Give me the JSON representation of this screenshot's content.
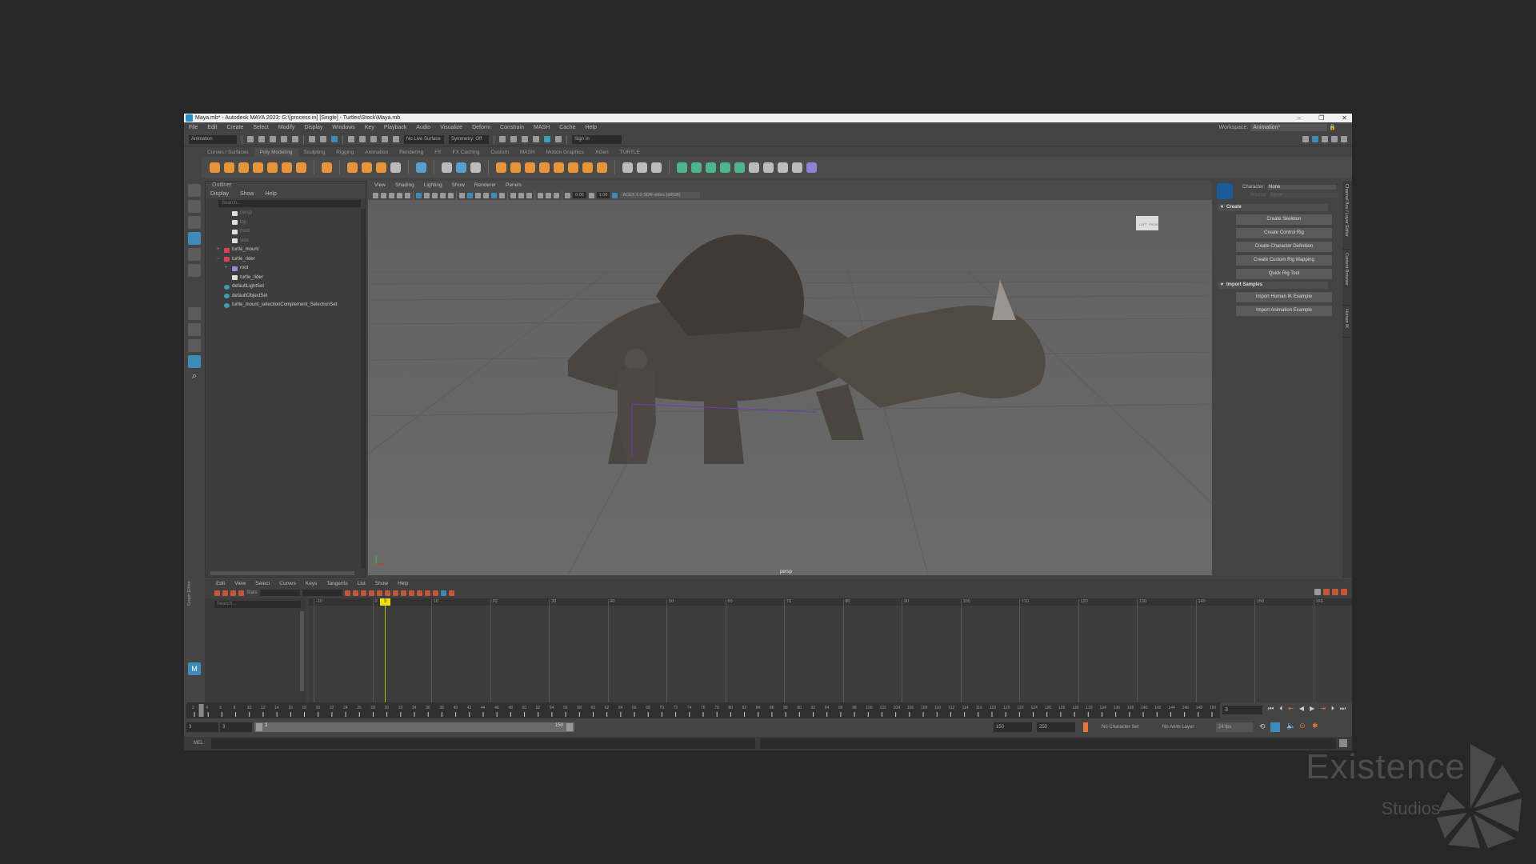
{
  "window": {
    "title": "Maya.mb* - Autodesk MAYA 2023: G:\\[process in] [Single] - Turtles\\Stock\\Maya.mb",
    "controls": [
      "–",
      "❐",
      "✕"
    ]
  },
  "menubar": [
    "File",
    "Edit",
    "Create",
    "Select",
    "Modify",
    "Display",
    "Windows",
    "Key",
    "Playback",
    "Audio",
    "Visualize",
    "Deform",
    "Constrain",
    "MASH",
    "Cache",
    "Help"
  ],
  "workspace": {
    "label": "Workspace:",
    "value": "Animation*"
  },
  "statusline": {
    "mode": "Animation",
    "live_surface": "No Live Surface",
    "symmetry": "Symmetry: Off",
    "sign_in": "Sign In"
  },
  "shelf": {
    "tabs": [
      "Curves / Surfaces",
      "Poly Modeling",
      "Sculpting",
      "Rigging",
      "Animation",
      "Rendering",
      "FX",
      "FX Caching",
      "Custom",
      "MASH",
      "Motion Graphics",
      "XGen",
      "TURTLE"
    ],
    "active": 1
  },
  "outliner": {
    "title": "Outliner",
    "menu": [
      "Display",
      "Show",
      "Help"
    ],
    "search_placeholder": "Search...",
    "items": [
      {
        "label": "persp",
        "indent": 1,
        "icon": "camera",
        "dim": true
      },
      {
        "label": "top",
        "indent": 1,
        "icon": "camera",
        "dim": true
      },
      {
        "label": "front",
        "indent": 1,
        "icon": "camera",
        "dim": true
      },
      {
        "label": "side",
        "indent": 1,
        "icon": "camera",
        "dim": true
      },
      {
        "label": "turtle_mount",
        "indent": 0,
        "icon": "transform",
        "expand": "+"
      },
      {
        "label": "turtle_rider",
        "indent": 0,
        "icon": "transform",
        "expand": "−"
      },
      {
        "label": "root",
        "indent": 1,
        "icon": "joint",
        "expand": "+"
      },
      {
        "label": "turtle_rider",
        "indent": 1,
        "icon": "mesh"
      },
      {
        "label": "defaultLightSet",
        "indent": 0,
        "icon": "set"
      },
      {
        "label": "defaultObjectSet",
        "indent": 0,
        "icon": "set"
      },
      {
        "label": "turtle_mount_selectionComplement_SelectionSet",
        "indent": 0,
        "icon": "set"
      }
    ]
  },
  "viewport": {
    "menu": [
      "View",
      "Shading",
      "Lighting",
      "Show",
      "Renderer",
      "Panels"
    ],
    "exposure": "0.00",
    "gamma": "1.00",
    "color_space": "ACES 1.0 SDR-video (sRGB)",
    "camera": "persp",
    "viewcube": [
      "LEFT",
      "FRONT"
    ]
  },
  "hik": {
    "character_label": "Character:",
    "character": "None",
    "source_label": "Source:",
    "source": "None",
    "sections": [
      {
        "title": "Create",
        "buttons": [
          "Create Skeleton",
          "Create Control Rig",
          "Create Character Definition",
          "Create Custom Rig Mapping",
          "Quick Rig Tool"
        ]
      },
      {
        "title": "Import Samples",
        "buttons": [
          "Import Human IK Example",
          "Import Animation Example"
        ]
      }
    ],
    "side_tabs": [
      "Channel Box / Layer Editor",
      "Content Browser",
      "Human IK"
    ]
  },
  "graph_editor": {
    "side_label": "Graph Editor",
    "menu": [
      "Edit",
      "View",
      "Select",
      "Curves",
      "Keys",
      "Tangents",
      "List",
      "Show",
      "Help"
    ],
    "stats_label": "Stats",
    "search_placeholder": "Search...",
    "ruler": [
      "-10",
      "0",
      "10",
      "20",
      "30",
      "40",
      "50",
      "60",
      "70",
      "80",
      "90",
      "100",
      "110",
      "120",
      "130",
      "140",
      "150",
      "160"
    ],
    "current_frame": "3"
  },
  "time_slider": {
    "start": 2,
    "end": 150,
    "step": 2,
    "current": "3",
    "current_field": "3"
  },
  "range": {
    "start": "3",
    "anim_start": "3",
    "slider_start": "3",
    "slider_end": "150",
    "end": "150",
    "anim_end": "250",
    "character_set": "No Character Set",
    "anim_layer": "No Anim Layer",
    "fps": "24 fps"
  },
  "command_line": {
    "label": "MEL"
  },
  "watermark": {
    "line1": "Existence",
    "line2": "Studios"
  }
}
